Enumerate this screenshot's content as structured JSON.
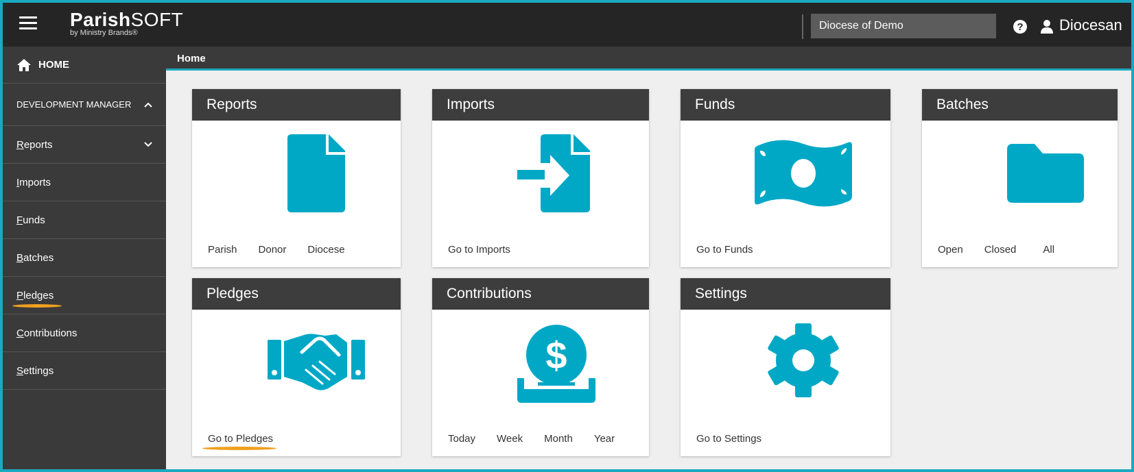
{
  "header": {
    "logo_main_bold": "Parish",
    "logo_main_rest": "SOFT",
    "logo_sub": "by Ministry Brands®",
    "diocese": "Diocese of Demo",
    "user": "Diocesan"
  },
  "sidebar": {
    "home": "HOME",
    "group": "DEVELOPMENT MANAGER",
    "items": [
      {
        "label": "Reports"
      },
      {
        "label": "Imports"
      },
      {
        "label": "Funds"
      },
      {
        "label": "Batches"
      },
      {
        "label": "Pledges"
      },
      {
        "label": "Contributions"
      },
      {
        "label": "Settings"
      }
    ]
  },
  "breadcrumb": "Home",
  "cards": {
    "reports": {
      "title": "Reports",
      "links": [
        "Parish",
        "Donor",
        "Diocese"
      ]
    },
    "imports": {
      "title": "Imports",
      "links": [
        "Go to Imports"
      ]
    },
    "funds": {
      "title": "Funds",
      "links": [
        "Go to Funds"
      ]
    },
    "batches": {
      "title": "Batches",
      "links": [
        "Open",
        "Closed",
        "All"
      ]
    },
    "pledges": {
      "title": "Pledges",
      "links": [
        "Go to Pledges"
      ]
    },
    "contributions": {
      "title": "Contributions",
      "links": [
        "Today",
        "Week",
        "Month",
        "Year"
      ]
    },
    "settings": {
      "title": "Settings",
      "links": [
        "Go to Settings"
      ]
    }
  },
  "colors": {
    "accent": "#00a8c6",
    "highlight": "#f0a020"
  }
}
